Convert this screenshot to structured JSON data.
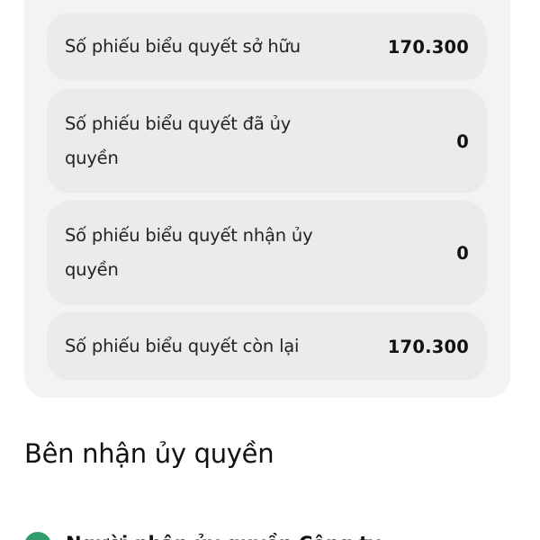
{
  "vote_summary": {
    "rows": [
      {
        "label": "Số phiếu biểu quyết sở hữu",
        "value": "170.300"
      },
      {
        "label": "Số phiếu biểu quyết đã ủy quyền",
        "value": "0"
      },
      {
        "label": "Số phiếu biểu quyết nhận ủy quyền",
        "value": "0"
      },
      {
        "label": "Số phiếu biểu quyết còn lại",
        "value": "170.300"
      }
    ]
  },
  "recipient_section": {
    "heading": "Bên nhận ủy quyền",
    "status_color": "#2e9c6d",
    "first_item_name": "Người nhận ủy quyền Công ty"
  }
}
